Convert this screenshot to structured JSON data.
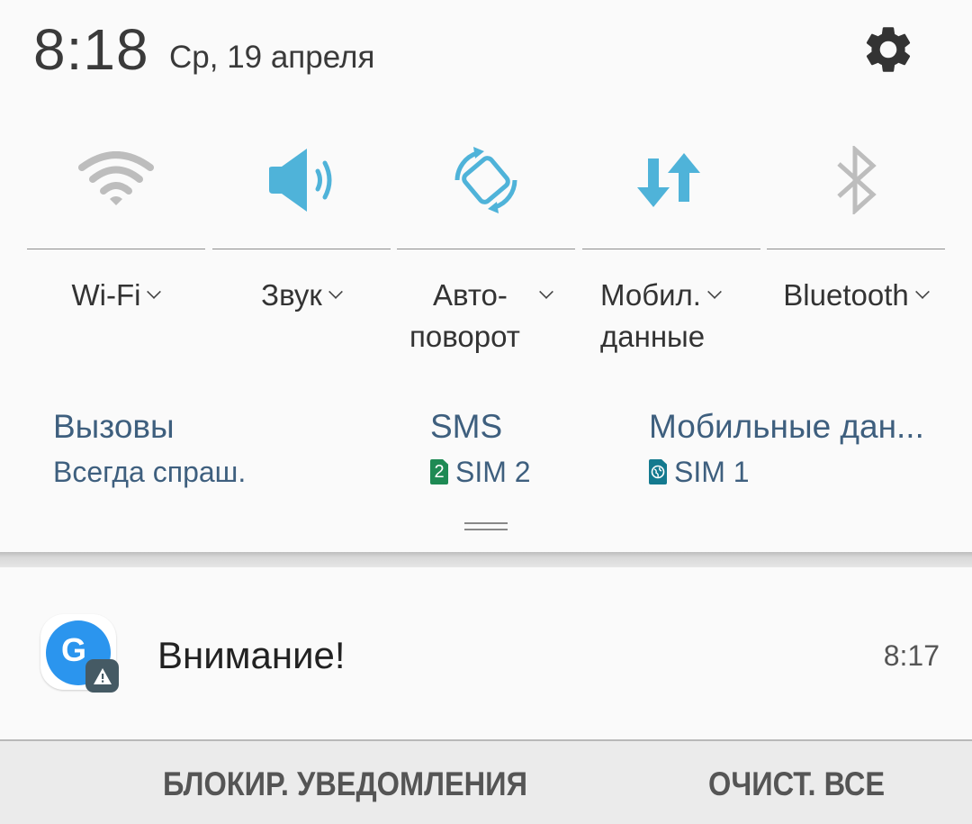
{
  "header": {
    "time": "8:18",
    "date": "Ср, 19 апреля",
    "settings_icon": "gear-icon"
  },
  "quick_toggles": [
    {
      "id": "wifi",
      "label": "Wi-Fi",
      "icon": "wifi-icon",
      "active": false,
      "color": "#bdbdbd"
    },
    {
      "id": "sound",
      "label": "Звук",
      "icon": "speaker-icon",
      "active": true,
      "color": "#4fb3d9"
    },
    {
      "id": "autorotate",
      "label_line1": "Авто-",
      "label_line2": "поворот",
      "icon": "rotate-icon",
      "active": true,
      "color": "#4fb3d9"
    },
    {
      "id": "mobile_data",
      "label_line1": "Мобил.",
      "label_line2": "данные",
      "icon": "data-arrows-icon",
      "active": true,
      "color": "#4fb3d9"
    },
    {
      "id": "bluetooth",
      "label": "Bluetooth",
      "icon": "bluetooth-icon",
      "active": false,
      "color": "#bdbdbd"
    }
  ],
  "sim_settings": [
    {
      "title": "Вызовы",
      "value": "Всегда спраш."
    },
    {
      "title": "SMS",
      "value": "SIM 2",
      "badge": "2",
      "badge_color": "#1e8a54"
    },
    {
      "title": "Мобильные дан...",
      "value": "SIM 1",
      "badge_icon": "globe-icon",
      "badge_color": "#147a8f"
    }
  ],
  "notification": {
    "app_icon": "google-g-icon",
    "app_letter": "G",
    "badge_icon": "warning-icon",
    "title": "Внимание!",
    "time": "8:17"
  },
  "actions": {
    "block": "БЛОКИР. УВЕДОМЛЕНИЯ",
    "clear": "ОЧИСТ. ВСЕ"
  }
}
